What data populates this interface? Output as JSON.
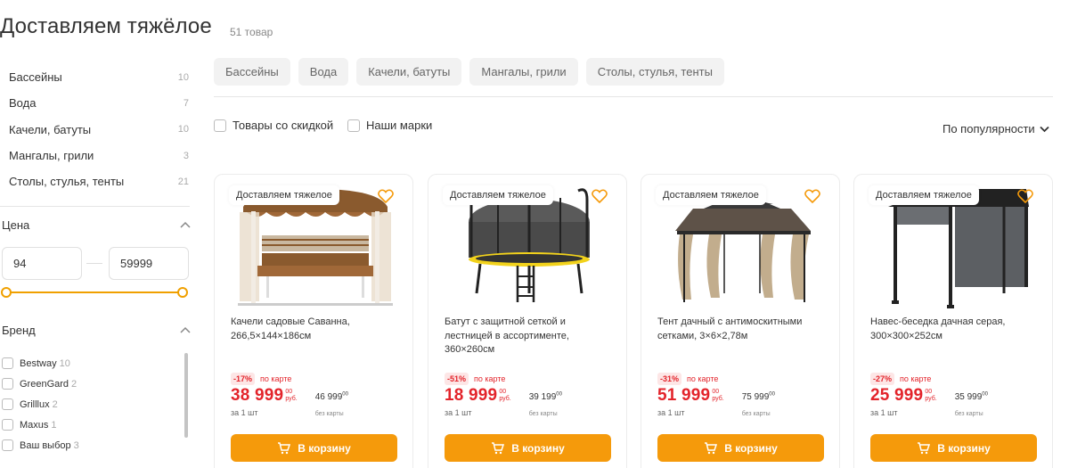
{
  "page": {
    "title": "Доставляем тяжёлое",
    "count": "51 товар"
  },
  "categories": [
    {
      "label": "Бассейны",
      "count": "10"
    },
    {
      "label": "Вода",
      "count": "7"
    },
    {
      "label": "Качели, батуты",
      "count": "10"
    },
    {
      "label": "Мангалы, грили",
      "count": "3"
    },
    {
      "label": "Столы, стулья, тенты",
      "count": "21"
    }
  ],
  "price_filter": {
    "title": "Цена",
    "min": "94",
    "max": "59999"
  },
  "brand_filter": {
    "title": "Бренд",
    "items": [
      {
        "label": "Bestway",
        "count": "10"
      },
      {
        "label": "GreenGard",
        "count": "2"
      },
      {
        "label": "Grilllux",
        "count": "2"
      },
      {
        "label": "Maxus",
        "count": "1"
      },
      {
        "label": "Ваш выбор",
        "count": "3"
      }
    ]
  },
  "chips": [
    "Бассейны",
    "Вода",
    "Качели, батуты",
    "Мангалы, грили",
    "Столы, стулья, тенты"
  ],
  "toolbar": {
    "discount_label": "Товары со скидкой",
    "our_brands_label": "Наши марки",
    "sort_label": "По популярности"
  },
  "products": [
    {
      "tag": "Доставляем тяжелое",
      "name": "Качели садовые Саванна, 266,5×144×186см",
      "discount": "-17%",
      "on_card": "по карте",
      "price": "38 999",
      "price_kop": "00",
      "price_cur": "руб.",
      "old_price": "46 999",
      "old_kop": "00",
      "old_label": "без карты",
      "unit": "за 1 шт",
      "cart": "В корзину"
    },
    {
      "tag": "Доставляем тяжелое",
      "name": "Батут с защитной сеткой и лестницей в ассортименте, 360×260см",
      "discount": "-51%",
      "on_card": "по карте",
      "price": "18 999",
      "price_kop": "00",
      "price_cur": "руб.",
      "old_price": "39 199",
      "old_kop": "00",
      "old_label": "без карты",
      "unit": "за 1 шт",
      "cart": "В корзину"
    },
    {
      "tag": "Доставляем тяжелое",
      "name": "Тент дачный с антимоскитными сетками, 3×6×2,78м",
      "discount": "-31%",
      "on_card": "по карте",
      "price": "51 999",
      "price_kop": "00",
      "price_cur": "руб.",
      "old_price": "75 999",
      "old_kop": "00",
      "old_label": "без карты",
      "unit": "за 1 шт",
      "cart": "В корзину"
    },
    {
      "tag": "Доставляем тяжелое",
      "name": "Навес-беседка дачная серая, 300×300×252см",
      "discount": "-27%",
      "on_card": "по карте",
      "price": "25 999",
      "price_kop": "00",
      "price_cur": "руб.",
      "old_price": "35 999",
      "old_kop": "00",
      "old_label": "без карты",
      "unit": "за 1 шт",
      "cart": "В корзину"
    }
  ],
  "colors": {
    "accent": "#f59a0b",
    "price_red": "#e3242b",
    "chip_bg": "#f2f2f2"
  }
}
